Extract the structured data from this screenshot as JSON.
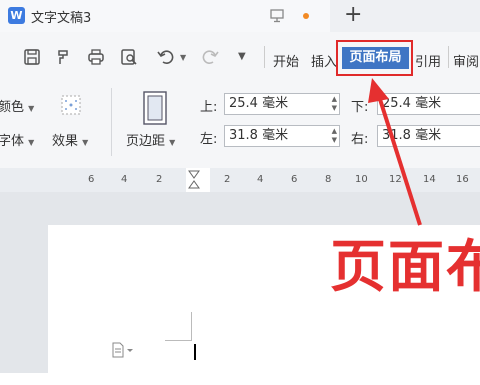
{
  "app": {
    "icon_letter": "W",
    "document_title": "文字文稿3",
    "new_tab_symbol": "+"
  },
  "toolbar": {
    "menu_tabs": [
      {
        "label": "开始"
      },
      {
        "label": "插入"
      },
      {
        "label": "页面布局",
        "active": true
      },
      {
        "label": "引用"
      },
      {
        "label": "审阅"
      }
    ],
    "icons": [
      "save-icon",
      "format-painter-icon",
      "print-icon",
      "print-preview-icon",
      "undo-icon",
      "redo-icon",
      "more-dropdown-icon"
    ]
  },
  "ribbon": {
    "color_label": "颜色",
    "font_label": "字体",
    "effects_label": "效果",
    "margins_label": "页边距",
    "margin_fields": [
      {
        "label": "上:",
        "value": "25.4 毫米"
      },
      {
        "label": "下:",
        "value": "25.4 毫米"
      },
      {
        "label": "左:",
        "value": "31.8 毫米"
      },
      {
        "label": "右:",
        "value": "31.8 毫米"
      }
    ]
  },
  "ruler": {
    "ticks": [
      "6",
      "4",
      "2",
      "2",
      "4",
      "6",
      "8",
      "10",
      "12",
      "14",
      "16"
    ]
  },
  "annotation": {
    "overlay_text": "页面布",
    "color": "#e53030"
  },
  "colors": {
    "accent": "#3f75c4",
    "highlight_border": "#e02a2a"
  }
}
